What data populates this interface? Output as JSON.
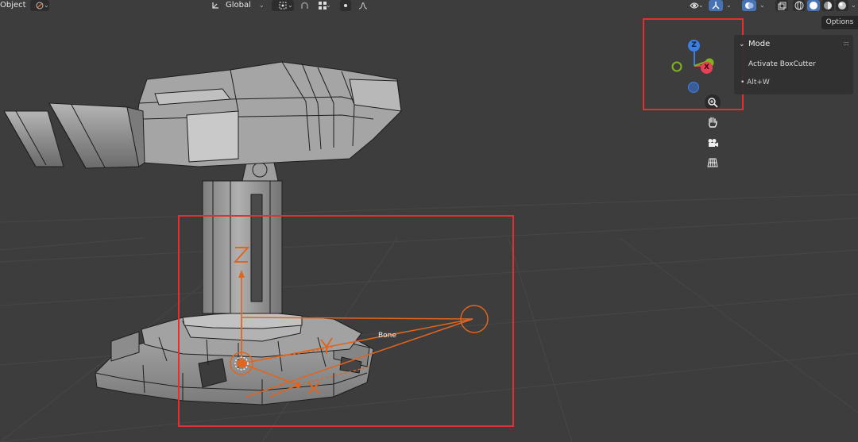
{
  "header": {
    "mode_label": "Object",
    "orientation_label": "Global"
  },
  "options_label": "Options",
  "redo_panel": {
    "title": "Mode",
    "operation": "Activate BoxCutter",
    "shortcut": "Alt+W"
  },
  "gizmo": {
    "z_label": "Z",
    "x_label": "X"
  },
  "bone": {
    "label": "Bone",
    "axis_z": "Z",
    "axis_y": "Y",
    "axis_x": "X"
  },
  "colors": {
    "viewport_bg": "#3d3d3d",
    "grid_line": "#474747",
    "mesh_face": "#9a9a9a",
    "mesh_edge": "#1e1e1e",
    "bone_orange": "#e0651e",
    "annotation_red": "#e2302e",
    "axis_x": "#e84057",
    "axis_y": "#7fb31e",
    "axis_z": "#3d7fe0",
    "active_button": "#4772b3"
  },
  "icons": [
    "object-mode-icon",
    "transform-pivot-icon",
    "snap-icon",
    "snap-grid-icon",
    "proportional-edit-icon",
    "falloff-icon",
    "visibility-icon",
    "gizmo-toggle-icon",
    "overlay-icon",
    "xray-icon",
    "shading-wireframe-icon",
    "shading-solid-icon",
    "shading-material-icon",
    "shading-rendered-icon",
    "zoom-icon",
    "hand-pan-icon",
    "camera-icon",
    "perspective-grid-icon"
  ]
}
